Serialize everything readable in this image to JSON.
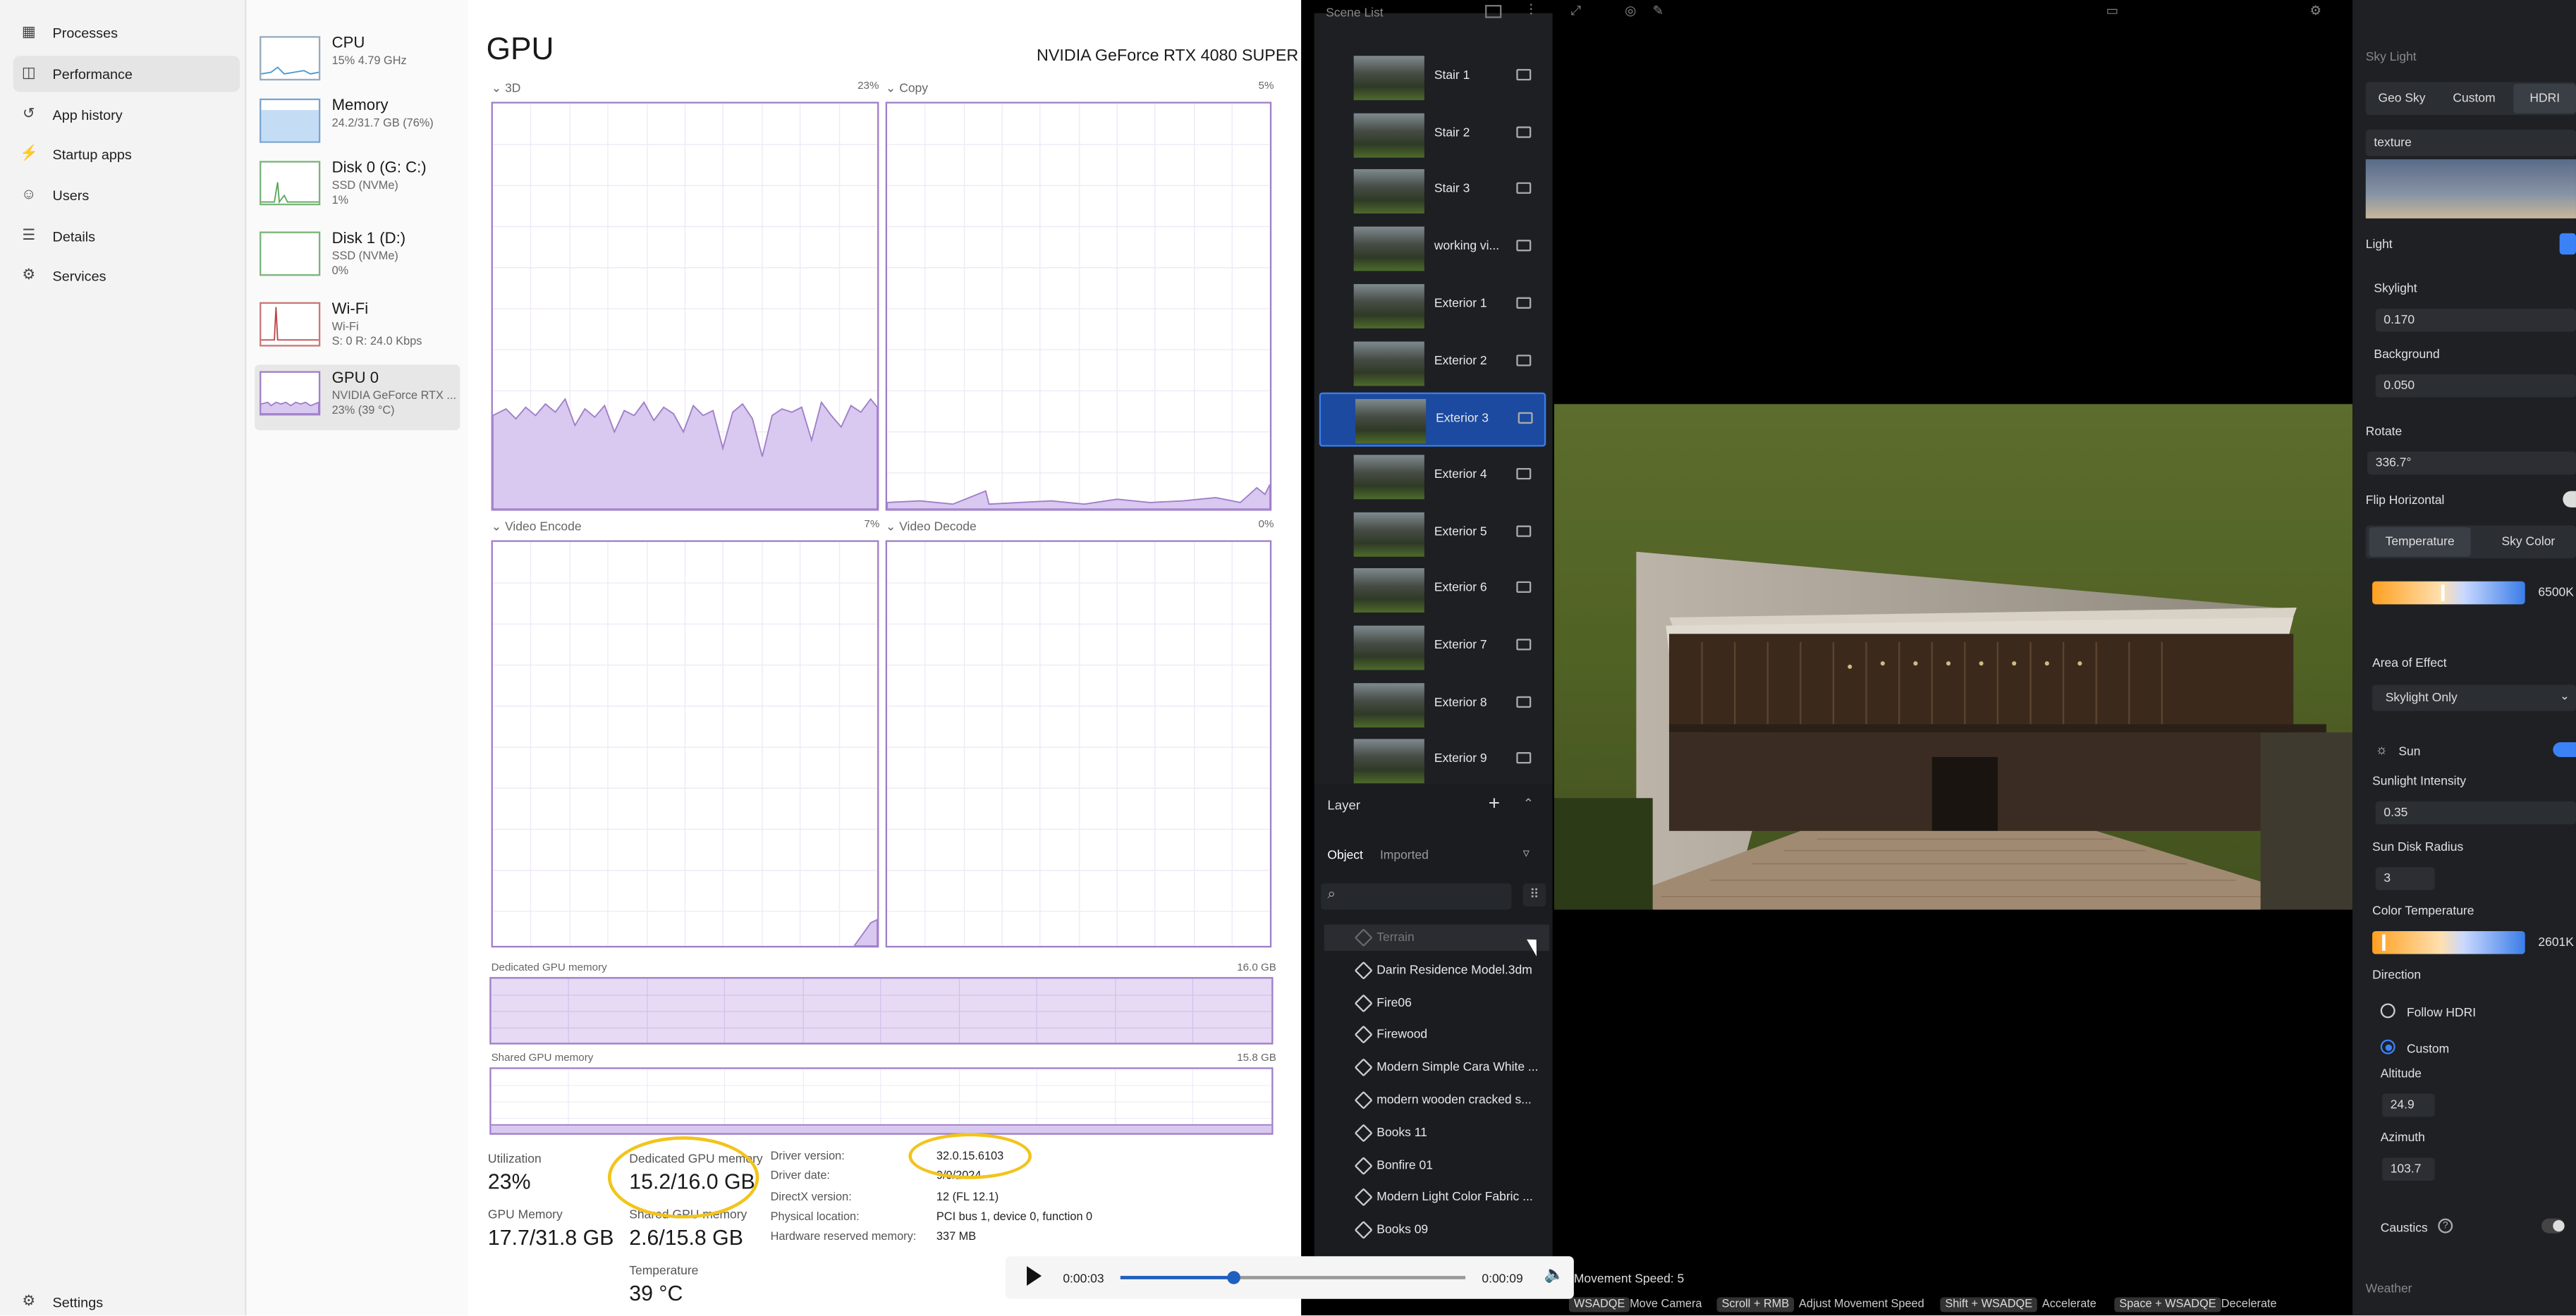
{
  "taskmanager": {
    "nav": [
      "Processes",
      "Performance",
      "App history",
      "Startup apps",
      "Users",
      "Details",
      "Services"
    ],
    "nav_active": "Performance",
    "settings": "Settings",
    "devices": [
      {
        "name": "CPU",
        "line1": "15% 4.79 GHz",
        "line2": ""
      },
      {
        "name": "Memory",
        "line1": "24.2/31.7 GB (76%)",
        "line2": ""
      },
      {
        "name": "Disk 0 (G: C:)",
        "line1": "SSD (NVMe)",
        "line2": "1%"
      },
      {
        "name": "Disk 1 (D:)",
        "line1": "SSD (NVMe)",
        "line2": "0%"
      },
      {
        "name": "Wi-Fi",
        "line1": "Wi-Fi",
        "line2": "S: 0 R: 24.0 Kbps"
      },
      {
        "name": "GPU 0",
        "line1": "NVIDIA GeForce RTX ...",
        "line2": "23% (39 °C)"
      }
    ],
    "title": "GPU",
    "gpu_model": "NVIDIA GeForce RTX 4080 SUPER",
    "graphs": [
      {
        "label": "3D",
        "pct": "23%"
      },
      {
        "label": "Copy",
        "pct": "5%"
      },
      {
        "label": "Video Encode",
        "pct": "7%"
      },
      {
        "label": "Video Decode",
        "pct": "0%"
      }
    ],
    "dedicated_label": "Dedicated GPU memory",
    "dedicated_max": "16.0 GB",
    "shared_label": "Shared GPU memory",
    "shared_max": "15.8 GB",
    "stats": {
      "utilization_label": "Utilization",
      "utilization": "23%",
      "dedicated_label": "Dedicated GPU memory",
      "dedicated": "15.2/16.0 GB",
      "gpu_memory_label": "GPU Memory",
      "gpu_memory": "17.7/31.8 GB",
      "shared_label": "Shared GPU memory",
      "shared": "2.6/15.8 GB",
      "temp_label": "Temperature",
      "temp": "39 °C"
    },
    "info": [
      {
        "k": "Driver version:",
        "v": "32.0.15.6103"
      },
      {
        "k": "Driver date:",
        "v": "9/9/2024"
      },
      {
        "k": "DirectX version:",
        "v": "12 (FL 12.1)"
      },
      {
        "k": "Physical location:",
        "v": "PCI bus 1, device 0, function 0"
      },
      {
        "k": "Hardware reserved memory:",
        "v": "337 MB"
      }
    ],
    "colors": {
      "accent": "#9f7fc8",
      "fill": "#d9c8f0",
      "highlight": "#f2c41c"
    }
  },
  "app": {
    "scene_list_title": "Scene List",
    "scenes": [
      "Stair 1",
      "Stair 2",
      "Stair 3",
      "working vi...",
      "Exterior 1",
      "Exterior 2",
      "Exterior 3",
      "Exterior 4",
      "Exterior 5",
      "Exterior 6",
      "Exterior 7",
      "Exterior 8",
      "Exterior 9"
    ],
    "selected_scene": "Exterior 3",
    "layer_title": "Layer",
    "layer_tabs": [
      "Object",
      "Imported"
    ],
    "layers": [
      "Terrain",
      "Darin Residence Model.3dm",
      "Fire06",
      "Firewood",
      "Modern Simple Cara White ...",
      "modern wooden cracked s...",
      "Books 11",
      "Bonfire 01",
      "Modern Light Color Fabric ...",
      "Books 09"
    ],
    "right": {
      "section": "Sky Light",
      "sky_tabs": [
        "Geo Sky",
        "Custom",
        "HDRI"
      ],
      "texture": "texture",
      "light": "Light",
      "skylight_label": "Skylight",
      "skylight": "0.170",
      "background_label": "Background",
      "background": "0.050",
      "rotate_label": "Rotate",
      "rotate": "336.7°",
      "flip": "Flip Horizontal",
      "color_tabs": [
        "Temperature",
        "Sky Color"
      ],
      "temp_value": "6500K",
      "aoe_label": "Area of Effect",
      "aoe": "Skylight Only",
      "sun": "Sun",
      "intensity_label": "Sunlight Intensity",
      "intensity": "0.35",
      "disk_label": "Sun Disk Radius",
      "disk": "3",
      "ctemp_label": "Color Temperature",
      "ctemp": "2601K",
      "direction": "Direction",
      "follow": "Follow HDRI",
      "custom": "Custom",
      "altitude_label": "Altitude",
      "altitude": "24.9",
      "azimuth_label": "Azimuth",
      "azimuth": "103.7",
      "caustics": "Caustics",
      "weather": "Weather"
    },
    "status": {
      "speed": "Movement Speed: 5",
      "hints": [
        {
          "k": "WSADQE",
          "l": "Move Camera"
        },
        {
          "k": "Scroll + RMB",
          "l": "Adjust Movement Speed"
        },
        {
          "k": "Shift + WSADQE",
          "l": "Accelerate"
        },
        {
          "k": "Space + WSADQE",
          "l": "Decelerate"
        }
      ]
    }
  },
  "player": {
    "current": "0:00:03",
    "total": "0:00:09",
    "progress": 0.33
  }
}
